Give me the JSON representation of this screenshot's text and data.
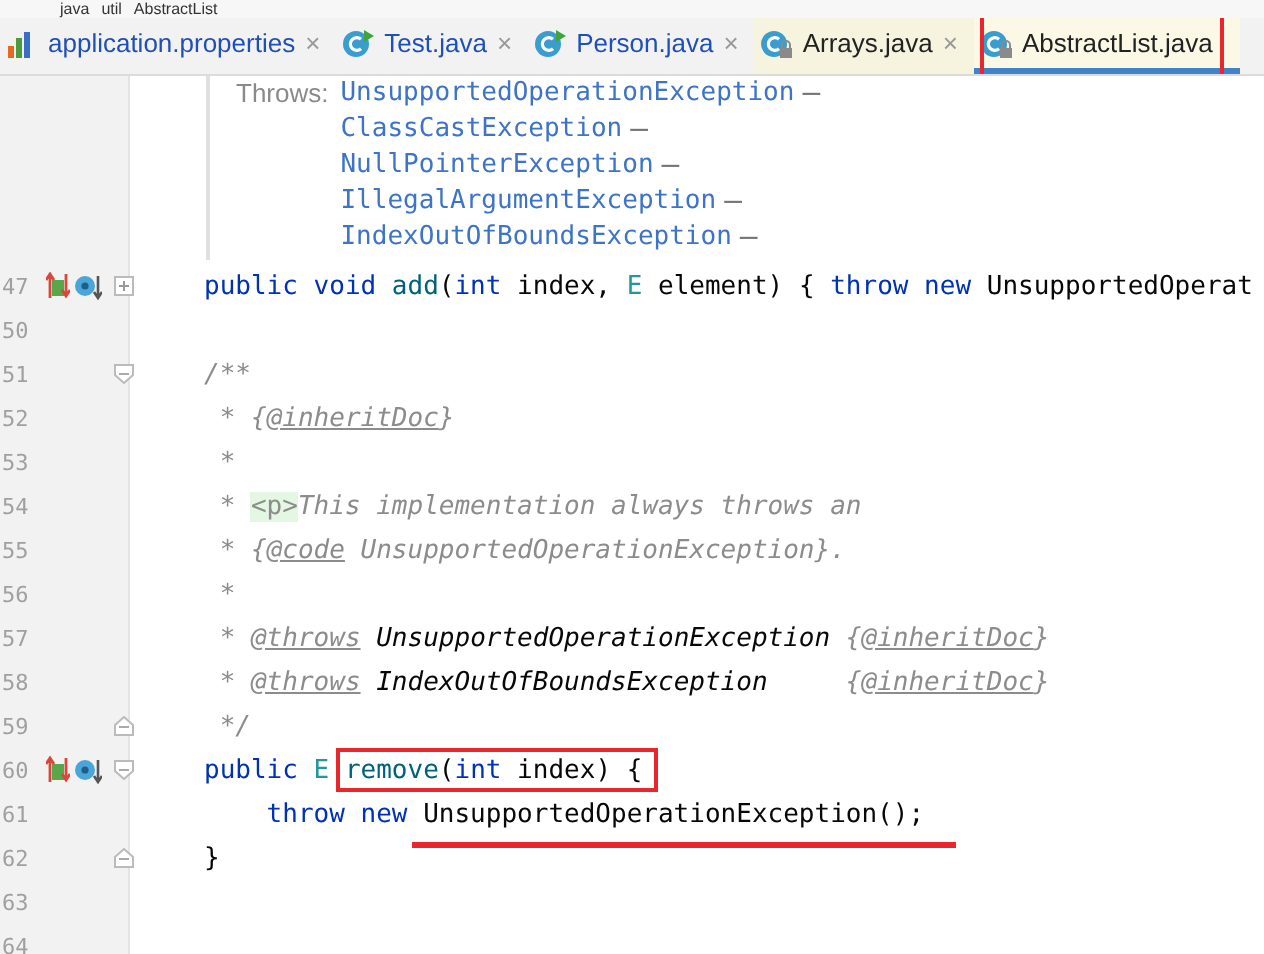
{
  "breadcrumb": [
    "java",
    "util",
    "AbstractList"
  ],
  "tabs": [
    {
      "label": "application.properties",
      "kind": "properties",
      "library": false,
      "selected": false,
      "boxed": false,
      "close": "×"
    },
    {
      "label": "Test.java",
      "kind": "class-run",
      "library": false,
      "selected": false,
      "boxed": false,
      "close": "×"
    },
    {
      "label": "Person.java",
      "kind": "class-run",
      "library": false,
      "selected": false,
      "boxed": false,
      "close": "×"
    },
    {
      "label": "Arrays.java",
      "kind": "class-locked",
      "library": true,
      "selected": false,
      "boxed": false,
      "close": "×"
    },
    {
      "label": "AbstractList.java",
      "kind": "class-locked",
      "library": true,
      "selected": true,
      "boxed": true
    }
  ],
  "doc": {
    "label": "Throws:",
    "exceptions": [
      {
        "name": "UnsupportedOperationException",
        "dash": "–"
      },
      {
        "name": "ClassCastException",
        "dash": "–"
      },
      {
        "name": "NullPointerException",
        "dash": "–"
      },
      {
        "name": "IllegalArgumentException",
        "dash": "–"
      },
      {
        "name": "IndexOutOfBoundsException",
        "dash": "–"
      }
    ]
  },
  "lines": [
    {
      "number": "47",
      "markers": true,
      "kind": "fold-expand",
      "tokens": [
        {
          "kind": "keyword",
          "text": "public void "
        },
        {
          "kind": "method",
          "text": "add"
        },
        {
          "kind": "plain",
          "text": "("
        },
        {
          "kind": "keyword",
          "text": "int"
        },
        {
          "kind": "plain",
          "text": " index, "
        },
        {
          "kind": "typeparam",
          "text": "E"
        },
        {
          "kind": "plain",
          "text": " element) { "
        },
        {
          "kind": "keyword",
          "text": "throw new "
        },
        {
          "kind": "plain",
          "text": "UnsupportedOperat"
        }
      ]
    },
    {
      "number": "50",
      "markers": false,
      "kind": "plain"
    },
    {
      "number": "51",
      "markers": false,
      "kind": "fold-start",
      "tokens": [
        {
          "kind": "comment",
          "text": "/**"
        }
      ]
    },
    {
      "number": "52",
      "markers": false,
      "kind": "plain",
      "tokens": [
        {
          "kind": "comment",
          "text": " * {"
        },
        {
          "kind": "doctag",
          "text": "@inheritDoc"
        },
        {
          "kind": "comment",
          "text": "}"
        }
      ]
    },
    {
      "number": "53",
      "markers": false,
      "kind": "plain",
      "tokens": [
        {
          "kind": "comment",
          "text": " *"
        }
      ]
    },
    {
      "number": "54",
      "markers": false,
      "kind": "plain",
      "tokens": [
        {
          "kind": "comment",
          "text": " * "
        },
        {
          "kind": "htmltag",
          "text": "<p>"
        },
        {
          "kind": "comment",
          "text": "This implementation always throws an"
        }
      ]
    },
    {
      "number": "55",
      "markers": false,
      "kind": "plain",
      "tokens": [
        {
          "kind": "comment",
          "text": " * {"
        },
        {
          "kind": "doctag",
          "text": "@code"
        },
        {
          "kind": "comment",
          "text": " UnsupportedOperationException}."
        }
      ]
    },
    {
      "number": "56",
      "markers": false,
      "kind": "plain",
      "tokens": [
        {
          "kind": "comment",
          "text": " *"
        }
      ]
    },
    {
      "number": "57",
      "markers": false,
      "kind": "plain",
      "tokens": [
        {
          "kind": "comment",
          "text": " * "
        },
        {
          "kind": "doctag",
          "text": "@throws"
        },
        {
          "kind": "doctype",
          "text": " UnsupportedOperationException"
        },
        {
          "kind": "comment",
          "text": " {"
        },
        {
          "kind": "doctag",
          "text": "@inheritDoc"
        },
        {
          "kind": "comment",
          "text": "}"
        }
      ]
    },
    {
      "number": "58",
      "markers": false,
      "kind": "plain",
      "tokens": [
        {
          "kind": "comment",
          "text": " * "
        },
        {
          "kind": "doctag",
          "text": "@throws"
        },
        {
          "kind": "doctype",
          "text": " IndexOutOfBoundsException"
        },
        {
          "kind": "comment",
          "text": "     {"
        },
        {
          "kind": "doctag",
          "text": "@inheritDoc"
        },
        {
          "kind": "comment",
          "text": "}"
        }
      ]
    },
    {
      "number": "59",
      "markers": false,
      "kind": "fold-end",
      "tokens": [
        {
          "kind": "comment",
          "text": " */"
        }
      ]
    },
    {
      "number": "60",
      "markers": true,
      "kind": "fold-start",
      "tokens": [
        {
          "kind": "keyword",
          "text": "public "
        },
        {
          "kind": "typeparam",
          "text": "E "
        },
        {
          "kind": "method",
          "text": "remove",
          "boxed": true
        },
        {
          "kind": "plain",
          "text": "(",
          "boxed": true
        },
        {
          "kind": "keyword",
          "text": "int",
          "boxed": true
        },
        {
          "kind": "plain",
          "text": " index) {",
          "boxed": true
        }
      ]
    },
    {
      "number": "61",
      "markers": false,
      "kind": "plain",
      "tokens": [
        {
          "kind": "keyword",
          "text": "    throw new "
        },
        {
          "kind": "plain",
          "text": "UnsupportedOperationException();",
          "underlined": true
        }
      ]
    },
    {
      "number": "62",
      "markers": false,
      "kind": "fold-end",
      "tokens": [
        {
          "kind": "plain",
          "text": "}"
        }
      ]
    },
    {
      "number": "63",
      "markers": false,
      "kind": "plain"
    },
    {
      "number": "64",
      "markers": false,
      "kind": "plain"
    }
  ]
}
